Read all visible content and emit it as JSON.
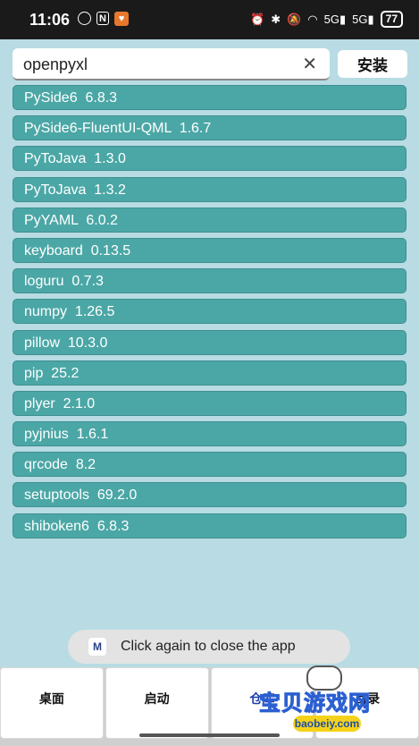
{
  "status_bar": {
    "time": "11:06",
    "battery": "77",
    "network_1": "5G",
    "network_2": "5G"
  },
  "search": {
    "value": "openpyxl",
    "clear_icon": "close-icon"
  },
  "install_button": "安装",
  "packages": [
    "PySide6  6.8.3",
    "PySide6-FluentUI-QML  1.6.7",
    "PyToJava  1.3.0",
    "PyToJava  1.3.2",
    "PyYAML  6.0.2",
    "keyboard  0.13.5",
    "loguru  0.7.3",
    "numpy  1.26.5",
    "pillow  10.3.0",
    "pip  25.2",
    "plyer  2.1.0",
    "pyjnius  1.6.1",
    "qrcode  8.2",
    "setuptools  69.2.0",
    "shiboken6  6.8.3"
  ],
  "toast": {
    "text": "Click again to close the app"
  },
  "nav": {
    "desktop": "桌面",
    "launch": "启动",
    "repo": "仓库",
    "about": "目录"
  },
  "watermark": {
    "text": "宝贝游戏网",
    "url": "baobeiy.com"
  },
  "colors": {
    "background": "#b8dbe4",
    "package_item": "#4ba7a6",
    "active_nav": "#1f3fae"
  }
}
